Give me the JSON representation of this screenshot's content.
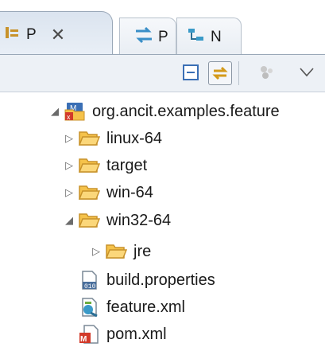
{
  "tabs": [
    {
      "label": "P",
      "active": true
    },
    {
      "label": "P",
      "active": false
    },
    {
      "label": "N",
      "active": false
    }
  ],
  "tree": {
    "root": {
      "label": "org.ancit.examples.feature",
      "expanded": true
    },
    "items": [
      {
        "label": "linux-64",
        "expanded": false
      },
      {
        "label": "target",
        "expanded": false
      },
      {
        "label": "win-64",
        "expanded": false
      },
      {
        "label": "win32-64",
        "expanded": true
      },
      {
        "label": "jre",
        "expanded": false
      },
      {
        "label": "build.properties"
      },
      {
        "label": "feature.xml"
      },
      {
        "label": "pom.xml"
      }
    ]
  },
  "colors": {
    "folder": "#f5c24a",
    "folder_edge": "#c8922a",
    "accent": "#3a6fb5",
    "maven_red": "#d23a2a"
  }
}
